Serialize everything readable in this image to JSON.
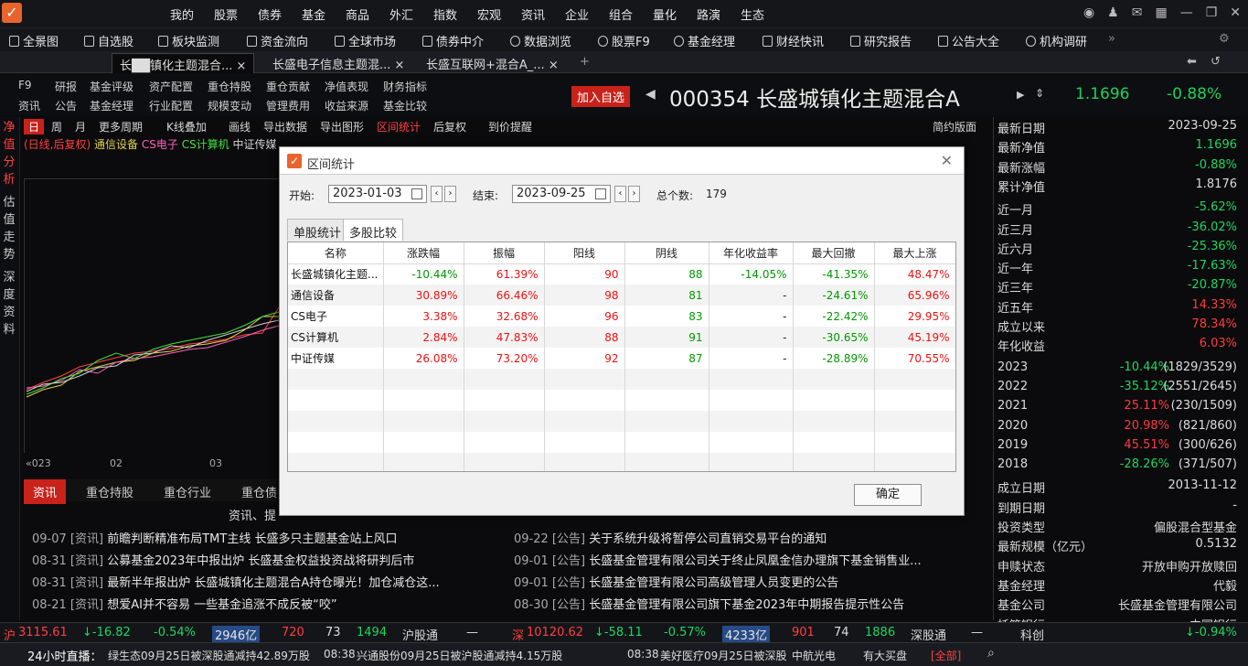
{
  "app": {
    "menus": [
      "我的",
      "股票",
      "债券",
      "基金",
      "商品",
      "外汇",
      "指数",
      "宏观",
      "资讯",
      "企业",
      "组合",
      "量化",
      "路演",
      "生态"
    ]
  },
  "toolbar": [
    "全景图",
    "自选股",
    "板块监测",
    "资金流向",
    "全球市场",
    "债券中介",
    "数据浏览",
    "股票F9",
    "基金经理",
    "财经快讯",
    "研究报告",
    "公告大全",
    "机构调研"
  ],
  "tabs": [
    "长██镇化主题混合...",
    "长盛电子信息主题混...",
    "长盛互联网+混合A_..."
  ],
  "nav_row1": [
    "F9",
    "研报",
    "基金评级",
    "资产配置",
    "重仓持股",
    "重仓贡献",
    "净值表现",
    "财务指标"
  ],
  "nav_row2": [
    "资讯",
    "公告",
    "基金经理",
    "行业配置",
    "规模变动",
    "管理费用",
    "收益来源",
    "基金比较"
  ],
  "header": {
    "add_fav": "加入自选",
    "title": "000354 长盛城镇化主题混合A",
    "price": "1.1696",
    "change": "-0.88%"
  },
  "chart_options": [
    "日",
    "周",
    "月",
    "更多周期",
    "K线叠加",
    "画线",
    "导出数据",
    "导出图形",
    "区间统计",
    "后复权",
    "到价提醒",
    "简约版面"
  ],
  "left_tabs": [
    "净值分析",
    "估值走势",
    "深度资料"
  ],
  "legend": [
    {
      "text": "(日线,后复权)",
      "color": "#ff4040"
    },
    {
      "text": "通信设备",
      "color": "#e0d050"
    },
    {
      "text": "CS电子",
      "color": "#ff60c0"
    },
    {
      "text": "CS计算机",
      "color": "#40e040"
    },
    {
      "text": "中证传媒",
      "color": "#d0d0d0"
    }
  ],
  "chart_xlabels": [
    "«023",
    "02",
    "03"
  ],
  "right_panel": {
    "stats": [
      {
        "k": "最新日期",
        "v": "2023-09-25",
        "c": ""
      },
      {
        "k": "最新净值",
        "v": "1.1696",
        "c": "g"
      },
      {
        "k": "最新涨幅",
        "v": "-0.88%",
        "c": "g"
      },
      {
        "k": "累计净值",
        "v": "1.8176",
        "c": ""
      },
      {
        "k": "近一月",
        "v": "-5.62%",
        "c": "g"
      },
      {
        "k": "近三月",
        "v": "-36.02%",
        "c": "g"
      },
      {
        "k": "近六月",
        "v": "-25.36%",
        "c": "g"
      },
      {
        "k": "近一年",
        "v": "-17.63%",
        "c": "g"
      },
      {
        "k": "近三年",
        "v": "-20.87%",
        "c": "g"
      },
      {
        "k": "近五年",
        "v": "14.33%",
        "c": "r"
      },
      {
        "k": "成立以来",
        "v": "78.34%",
        "c": "r"
      },
      {
        "k": "年化收益",
        "v": "6.03%",
        "c": "r"
      }
    ],
    "years": [
      {
        "y": "2023",
        "p": "-10.44%",
        "c": "g",
        "rank": "(1829/3529)"
      },
      {
        "y": "2022",
        "p": "-35.12%",
        "c": "g",
        "rank": "(2551/2645)"
      },
      {
        "y": "2021",
        "p": "25.11%",
        "c": "r",
        "rank": "(230/1509)"
      },
      {
        "y": "2020",
        "p": "20.98%",
        "c": "r",
        "rank": "(821/860)"
      },
      {
        "y": "2019",
        "p": "45.51%",
        "c": "r",
        "rank": "(300/626)"
      },
      {
        "y": "2018",
        "p": "-28.26%",
        "c": "g",
        "rank": "(371/507)"
      }
    ],
    "info": [
      {
        "k": "成立日期",
        "v": "2013-11-12"
      },
      {
        "k": "到期日期",
        "v": "-"
      },
      {
        "k": "投资类型",
        "v": "偏股混合型基金"
      },
      {
        "k": "最新规模（亿元）",
        "v": "0.5132"
      },
      {
        "k": "申赎状态",
        "v": "开放申购开放赎回"
      },
      {
        "k": "基金经理",
        "v": "代毅"
      },
      {
        "k": "基金公司",
        "v": "长盛基金管理有限公司"
      },
      {
        "k": "托管银行",
        "v": "中国银行"
      }
    ]
  },
  "lower_tabs": [
    "资讯",
    "重仓持股",
    "重仓行业",
    "重仓债"
  ],
  "news_header": "资讯、提",
  "news_left": [
    {
      "d": "09-07",
      "t": "[资讯]",
      "s": "前瞻判断精准布局TMT主线 长盛多只主题基金站上风口"
    },
    {
      "d": "08-31",
      "t": "[资讯]",
      "s": "公募基金2023年中报出炉 长盛基金权益投资战将研判后市"
    },
    {
      "d": "08-31",
      "t": "[资讯]",
      "s": "最新半年报出炉 长盛城镇化主题混合A持仓曝光！加仓减仓这..."
    },
    {
      "d": "08-21",
      "t": "[资讯]",
      "s": "想爱AI并不容易 一些基金追涨不成反被“咬”"
    }
  ],
  "news_right": [
    {
      "d": "09-22",
      "t": "[公告]",
      "s": "关于系统升级将暂停公司直销交易平台的通知"
    },
    {
      "d": "09-01",
      "t": "[公告]",
      "s": "长盛基金管理有限公司关于终止凤凰金信办理旗下基金销售业..."
    },
    {
      "d": "09-01",
      "t": "[公告]",
      "s": "长盛基金管理有限公司高级管理人员变更的公告"
    },
    {
      "d": "08-30",
      "t": "[公告]",
      "s": "长盛基金管理有限公司旗下基金2023年中期报告提示性公告"
    }
  ],
  "status1": {
    "sh": "沪",
    "sh_idx": "3115.61",
    "sh_chg": "↓-16.82",
    "sh_pct": "-0.54%",
    "sh_amt": "2946亿",
    "sh_up": "720",
    "sh_flat": "73",
    "sh_down": "1494",
    "sh_conn": "沪股通",
    "sz": "深",
    "sz_idx": "10120.62",
    "sz_chg": "↓-58.11",
    "sz_pct": "-0.57%",
    "sz_amt": "4233亿",
    "sz_up": "901",
    "sz_flat": "74",
    "sz_down": "1886",
    "sz_conn": "深股通",
    "kc": "科创",
    "kc_pct": "↓-0.94%"
  },
  "status2": {
    "live": "24小时直播：",
    "n1": "绿生态09月25日被深股通减持42.89万股",
    "t2": "08:38",
    "n2": "兴通股份09月25日被沪股通减持4.15万股",
    "t3": "08:38",
    "n3": "美好医疗09月25日被深股",
    "n4": "中航光电",
    "n5": "有大买盘",
    "all": "[全部]"
  },
  "dialog": {
    "title": "区间统计",
    "start_label": "开始:",
    "start": "2023-01-03",
    "end_label": "结束:",
    "end": "2023-09-25",
    "count_label": "总个数:",
    "count": "179",
    "tabs": [
      "单股统计",
      "多股比较"
    ],
    "columns": [
      "名称",
      "涨跌幅",
      "振幅",
      "阳线",
      "阴线",
      "年化收益率",
      "最大回撤",
      "最大上涨"
    ],
    "rows": [
      [
        "长盛城镇化主题...",
        "-10.44%",
        "61.39%",
        "90",
        "88",
        "-14.05%",
        "-41.35%",
        "48.47%"
      ],
      [
        "通信设备",
        "30.89%",
        "66.46%",
        "98",
        "81",
        "-",
        "-24.61%",
        "65.96%"
      ],
      [
        "CS电子",
        "3.38%",
        "32.68%",
        "96",
        "83",
        "-",
        "-22.42%",
        "29.95%"
      ],
      [
        "CS计算机",
        "2.84%",
        "47.83%",
        "88",
        "91",
        "-",
        "-30.65%",
        "45.19%"
      ],
      [
        "中证传媒",
        "26.08%",
        "73.20%",
        "92",
        "87",
        "-",
        "-28.89%",
        "70.55%"
      ]
    ],
    "ok": "确定"
  }
}
